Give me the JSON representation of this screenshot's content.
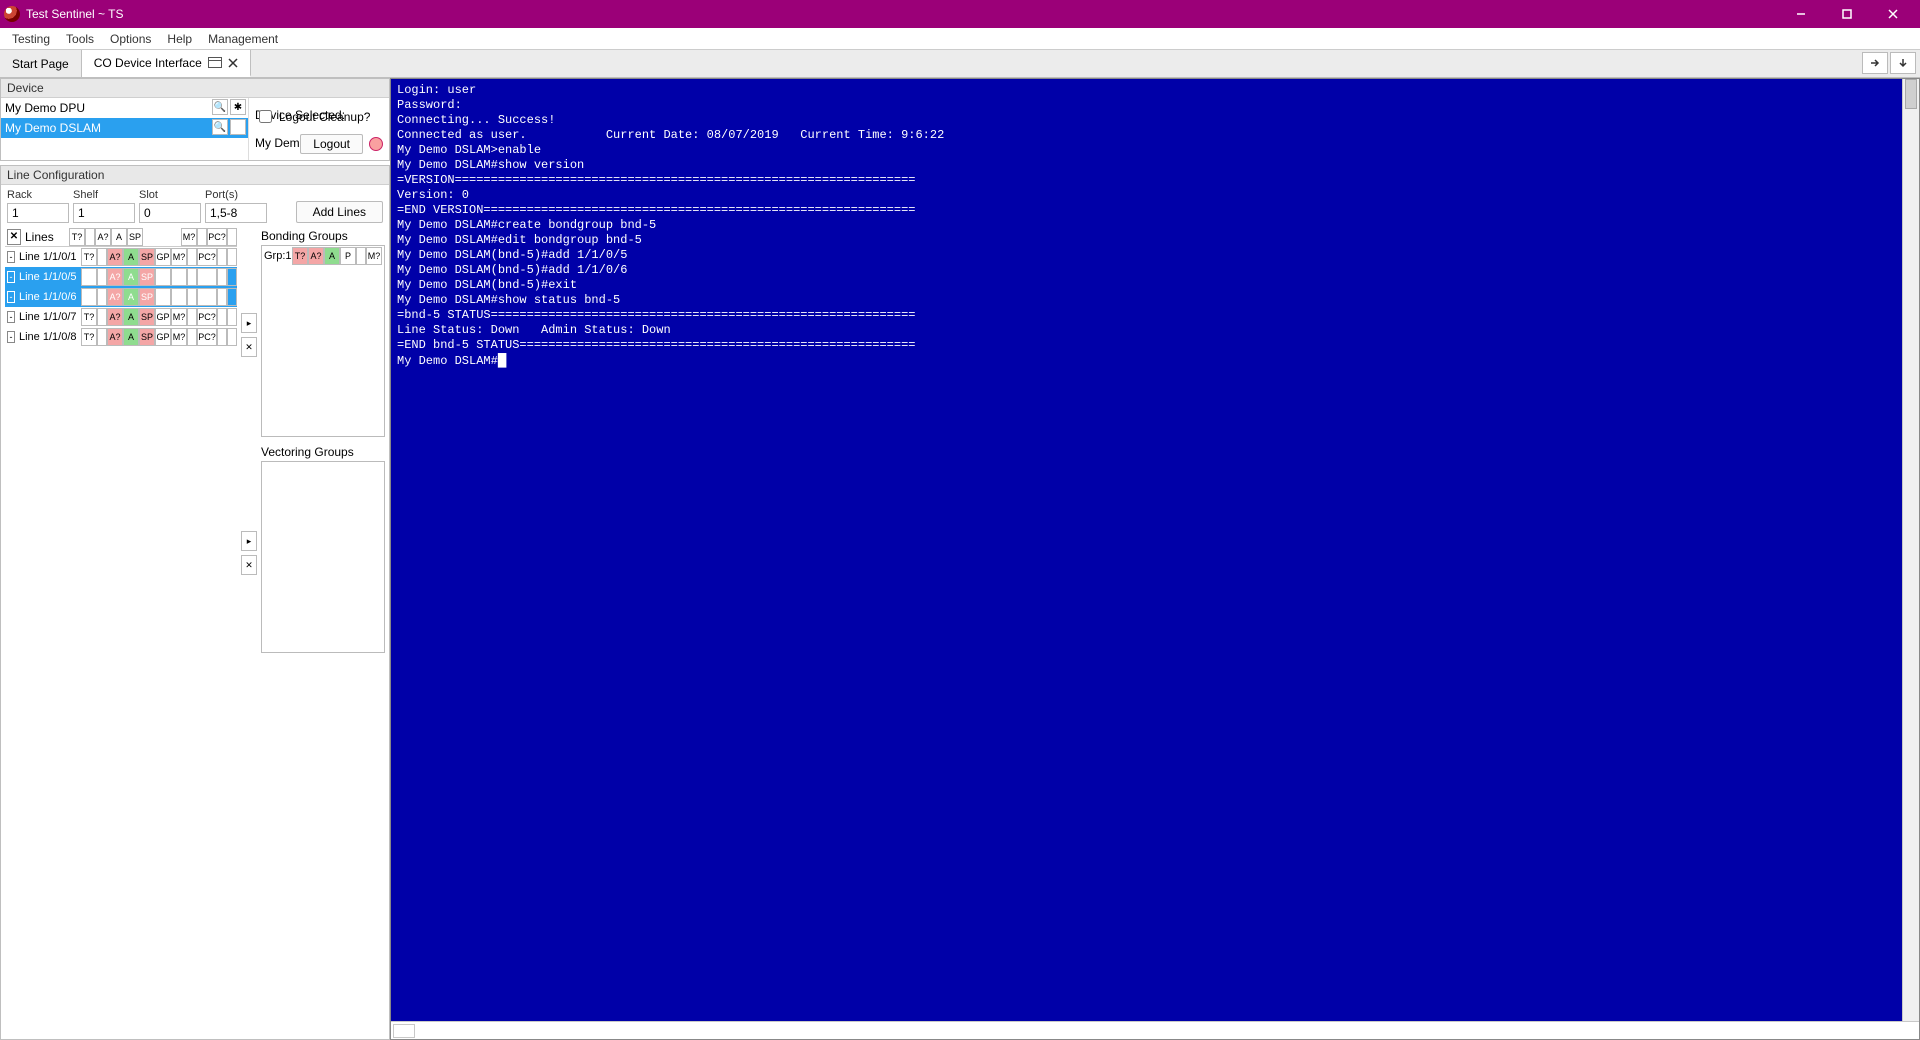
{
  "title": "Test Sentinel ~ TS",
  "menu": [
    "Testing",
    "Tools",
    "Options",
    "Help",
    "Management"
  ],
  "tabs": [
    {
      "label": "Start Page",
      "active": false,
      "closable": false
    },
    {
      "label": "CO Device Interface",
      "active": true,
      "closable": true
    }
  ],
  "device_panel": {
    "header": "Device",
    "devices": [
      {
        "name": "My Demo DPU",
        "selected": false
      },
      {
        "name": "My Demo DSLAM",
        "selected": true
      }
    ],
    "selected_label": "Device Selected:",
    "selected_value": "My Demo DSLAM",
    "logout_cleanup_label": "Logout Cleanup?",
    "logout_btn": "Logout"
  },
  "linecfg": {
    "header": "Line Configuration",
    "fields": {
      "rack": {
        "label": "Rack",
        "value": "1"
      },
      "shelf": {
        "label": "Shelf",
        "value": "1"
      },
      "slot": {
        "label": "Slot",
        "value": "0"
      },
      "ports": {
        "label": "Port(s)",
        "value": "1,5-8"
      }
    },
    "add_lines": "Add Lines",
    "lines_label": "Lines",
    "hdr_cells": [
      "T?",
      "",
      "A?",
      "A",
      "SP",
      "",
      "",
      "M?",
      "",
      "PC?",
      ""
    ],
    "lines": [
      {
        "label": "Line 1/1/0/1",
        "selected": false
      },
      {
        "label": "Line 1/1/0/5",
        "selected": true
      },
      {
        "label": "Line 1/1/0/6",
        "selected": true
      },
      {
        "label": "Line 1/1/0/7",
        "selected": false
      },
      {
        "label": "Line 1/1/0/8",
        "selected": false
      }
    ],
    "row_cells": [
      "T?",
      "",
      "A?",
      "A",
      "SP",
      "GP",
      "M?",
      "",
      "PC?",
      "",
      ""
    ],
    "bonding_label": "Bonding Groups",
    "bonding_group": {
      "label": "Grp:1",
      "cells": [
        "T?",
        "A?",
        "A",
        "P",
        "",
        "M?"
      ]
    },
    "vectoring_label": "Vectoring Groups"
  },
  "terminal_lines": [
    "Login: user",
    "Password:",
    "Connecting... Success!",
    "Connected as user.           Current Date: 08/07/2019   Current Time: 9:6:22",
    "My Demo DSLAM>enable",
    "My Demo DSLAM#show version",
    "=VERSION================================================================",
    "Version: 0",
    "=END VERSION============================================================",
    "My Demo DSLAM#create bondgroup bnd-5",
    "My Demo DSLAM#edit bondgroup bnd-5",
    "My Demo DSLAM(bnd-5)#add 1/1/0/5",
    "My Demo DSLAM(bnd-5)#add 1/1/0/6",
    "My Demo DSLAM(bnd-5)#exit",
    "My Demo DSLAM#show status bnd-5",
    "=bnd-5 STATUS===========================================================",
    "Line Status: Down   Admin Status: Down",
    "=END bnd-5 STATUS=======================================================",
    "My Demo DSLAM#"
  ]
}
